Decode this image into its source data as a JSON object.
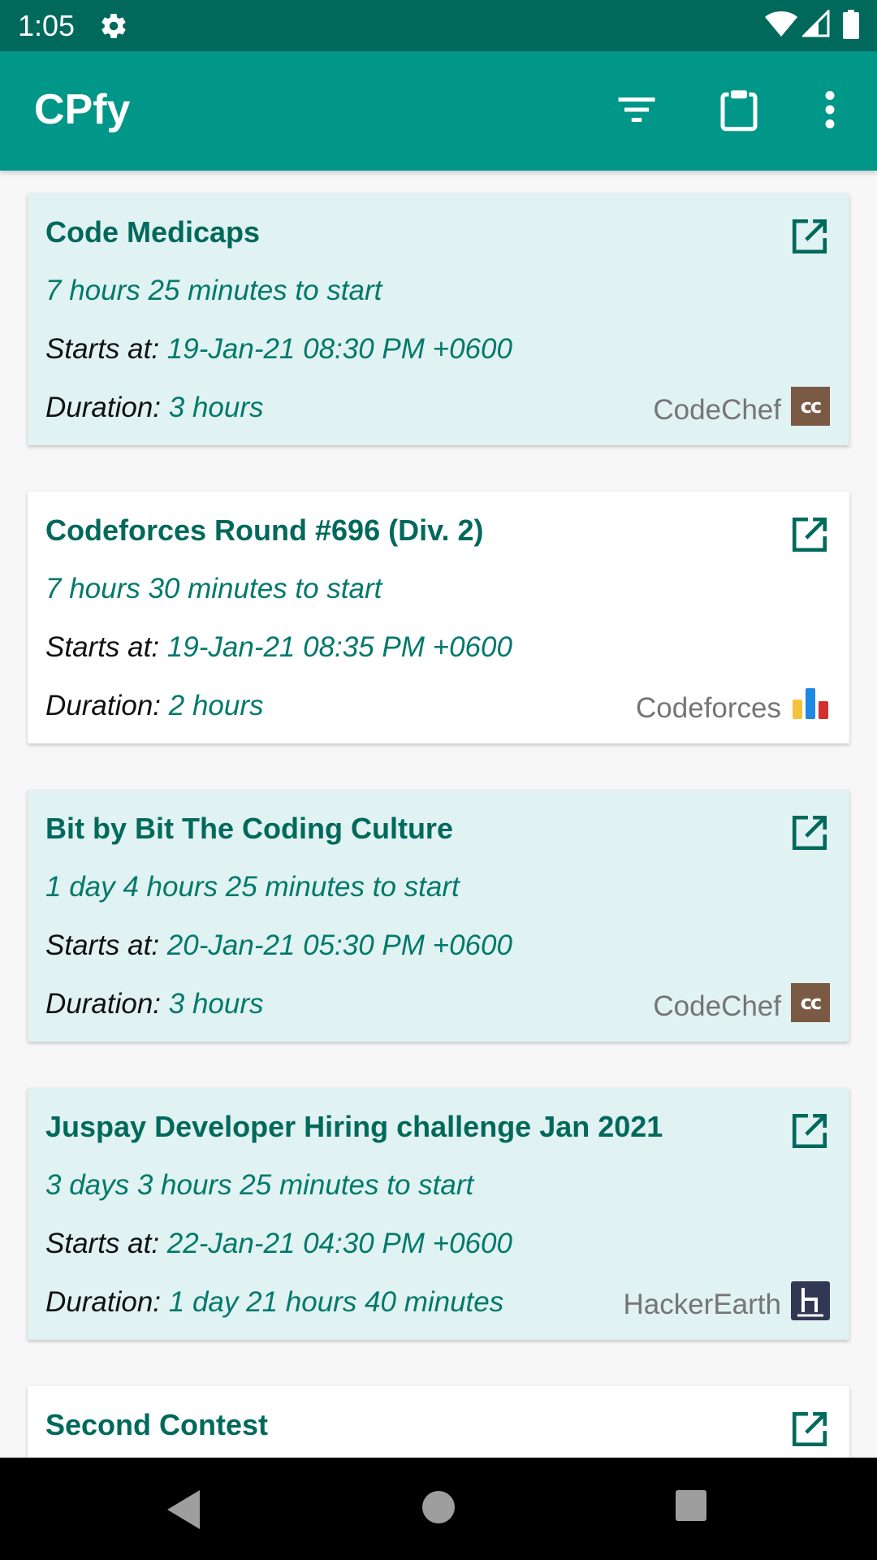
{
  "status_bar": {
    "time": "1:05",
    "icons": [
      "gear-icon",
      "wifi-icon",
      "signal-icon",
      "battery-icon"
    ]
  },
  "app_bar": {
    "title": "CPfy",
    "actions": [
      "filter-icon",
      "clipboard-icon",
      "more-vert-icon"
    ]
  },
  "colors": {
    "status_bar": "#00695c",
    "app_bar": "#009688",
    "card_highlight": "#e0f2f1",
    "accent_text": "#00796b"
  },
  "labels": {
    "starts_at": "Starts at:",
    "duration": "Duration:"
  },
  "contests": [
    {
      "title": "Code Medicaps",
      "time_left": "7 hours 25 minutes to start",
      "starts_at": "19-Jan-21 08:30 PM +0600",
      "duration": "3 hours",
      "platform": "CodeChef",
      "logo": "codechef-logo",
      "highlighted": true
    },
    {
      "title": "Codeforces Round #696 (Div. 2)",
      "time_left": "7 hours 30 minutes to start",
      "starts_at": "19-Jan-21 08:35 PM +0600",
      "duration": "2 hours",
      "platform": "Codeforces",
      "logo": "codeforces-logo",
      "highlighted": false
    },
    {
      "title": "Bit by Bit The Coding Culture",
      "time_left": "1 day 4 hours 25 minutes to start",
      "starts_at": "20-Jan-21 05:30 PM +0600",
      "duration": "3 hours",
      "platform": "CodeChef",
      "logo": "codechef-logo",
      "highlighted": true
    },
    {
      "title": "Juspay Developer Hiring challenge Jan 2021",
      "time_left": "3 days 3 hours 25 minutes to start",
      "starts_at": "22-Jan-21 04:30 PM +0600",
      "duration": "1 day 21 hours 40 minutes",
      "platform": "HackerEarth",
      "logo": "hackerearth-logo",
      "highlighted": true
    },
    {
      "title": "Second Contest",
      "highlighted": false
    }
  ],
  "nav_bar": {
    "buttons": [
      "back-icon",
      "home-icon",
      "recents-icon"
    ]
  }
}
